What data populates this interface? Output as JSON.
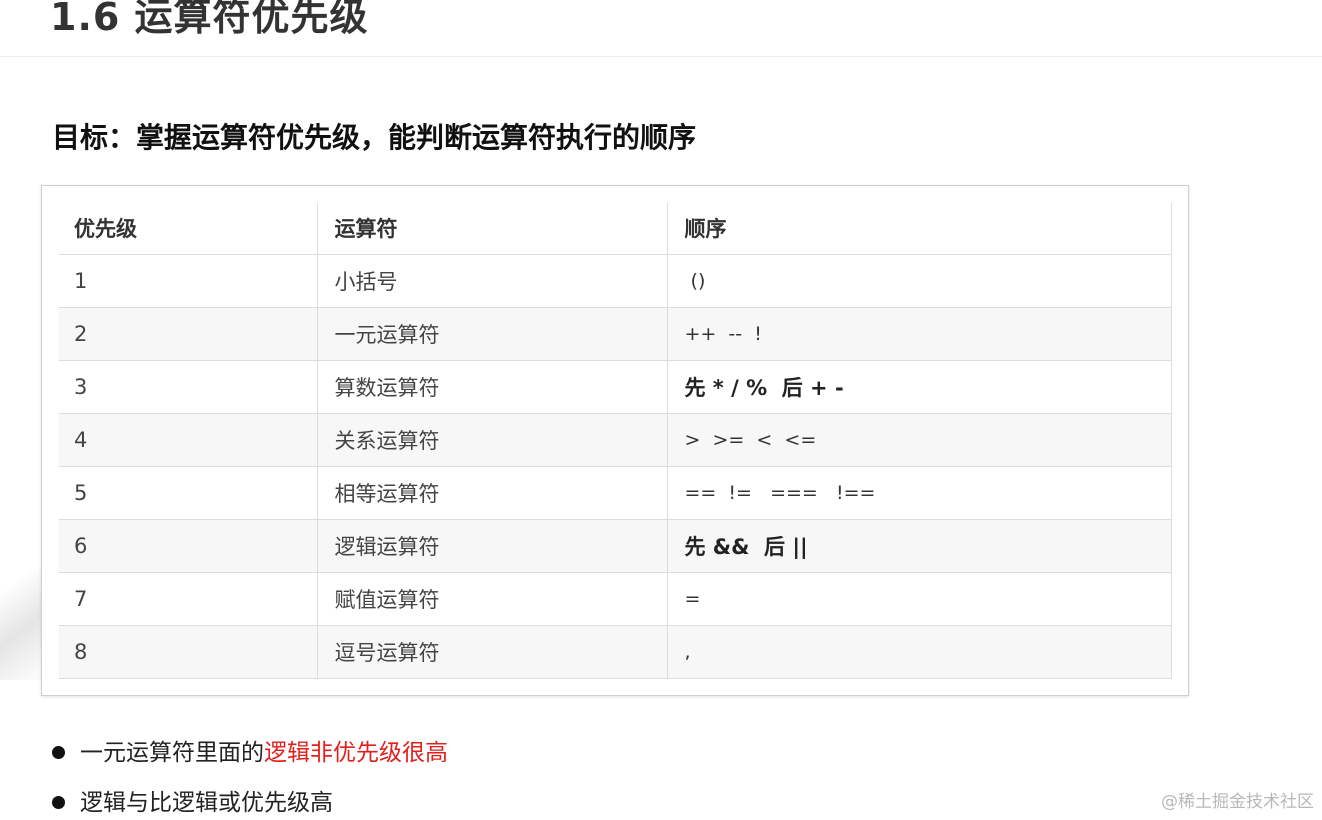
{
  "heading": "1.6 运算符优先级",
  "goal": "目标：掌握运算符优先级，能判断运算符执行的顺序",
  "table": {
    "headers": [
      "优先级",
      "运算符",
      "顺序"
    ],
    "rows": [
      {
        "priority": "1",
        "operator": "小括号",
        "order": " ()",
        "bold": false
      },
      {
        "priority": "2",
        "operator": "一元运算符",
        "order": "++  --  !",
        "bold": false
      },
      {
        "priority": "3",
        "operator": "算数运算符",
        "order": "先 * / %  后 + -",
        "bold": true
      },
      {
        "priority": "4",
        "operator": "关系运算符",
        "order": ">  >=  <  <=",
        "bold": false
      },
      {
        "priority": "5",
        "operator": "相等运算符",
        "order": "==  !=   ===   !==",
        "bold": false
      },
      {
        "priority": "6",
        "operator": "逻辑运算符",
        "order": "先 &&  后 ||",
        "bold": true
      },
      {
        "priority": "7",
        "operator": "赋值运算符",
        "order": "=",
        "bold": false
      },
      {
        "priority": "8",
        "operator": "逗号运算符",
        "order": ",",
        "bold": false
      }
    ]
  },
  "bullets": [
    {
      "text": "一元运算符里面的",
      "highlight": "逻辑非优先级很高"
    },
    {
      "text": "逻辑与比逻辑或优先级高",
      "highlight": ""
    }
  ],
  "watermark": "@稀土掘金技术社区",
  "colors": {
    "highlight": "#e0201c",
    "border": "#dddddd",
    "stripe": "#f7f7f7"
  }
}
